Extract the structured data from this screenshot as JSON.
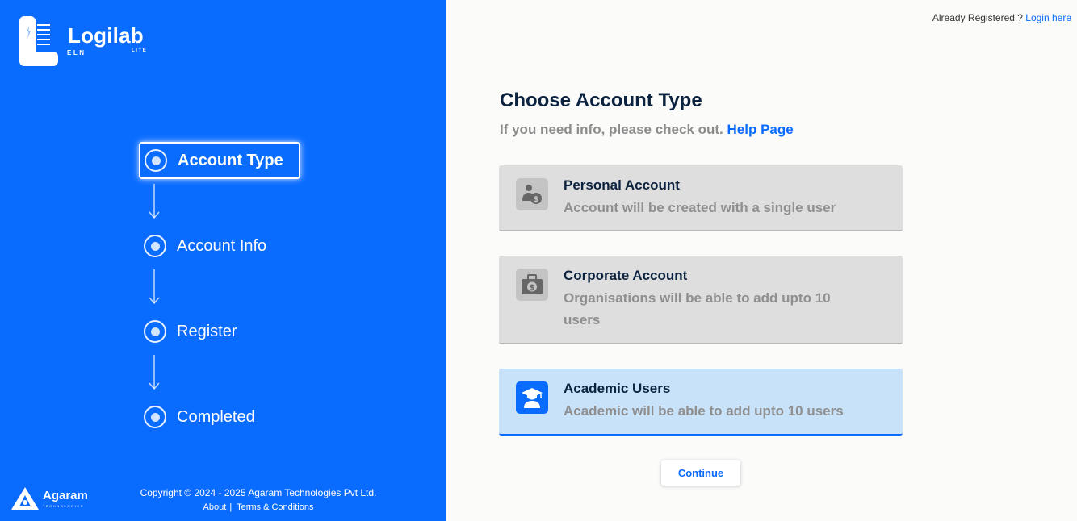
{
  "brand": {
    "name": "Logilab",
    "sub": "ELN",
    "edition": "LITE"
  },
  "steps": [
    {
      "label": "Account Type",
      "active": true
    },
    {
      "label": "Account Info",
      "active": false
    },
    {
      "label": "Register",
      "active": false
    },
    {
      "label": "Completed",
      "active": false
    }
  ],
  "footer": {
    "company": "Agaram",
    "company_sub": "TECHNOLOGIES",
    "copyright": "Copyright © 2024 - 2025 Agaram Technologies Pvt Ltd.",
    "about": "About",
    "separator": "|",
    "terms": "Terms & Conditions"
  },
  "header": {
    "prompt": "Already Registered ?",
    "login_link": "Login here"
  },
  "main": {
    "title": "Choose Account Type",
    "subtitle": "If you need info, please check out.",
    "help_link": "Help Page",
    "cards": [
      {
        "title": "Personal Account",
        "desc": "Account will be created with a single user",
        "icon": "person-dollar-icon",
        "selected": false
      },
      {
        "title": "Corporate Account",
        "desc": "Organisations will be able to add upto 10 users",
        "icon": "briefcase-dollar-icon",
        "selected": false
      },
      {
        "title": "Academic Users",
        "desc": "Academic will be able to add upto 10 users",
        "icon": "graduate-icon",
        "selected": true
      }
    ],
    "continue_label": "Continue"
  },
  "colors": {
    "brand_blue": "#0a6cff",
    "selected_bg": "#c8e2fa",
    "card_bg": "#dedede",
    "title": "#0c2340"
  }
}
